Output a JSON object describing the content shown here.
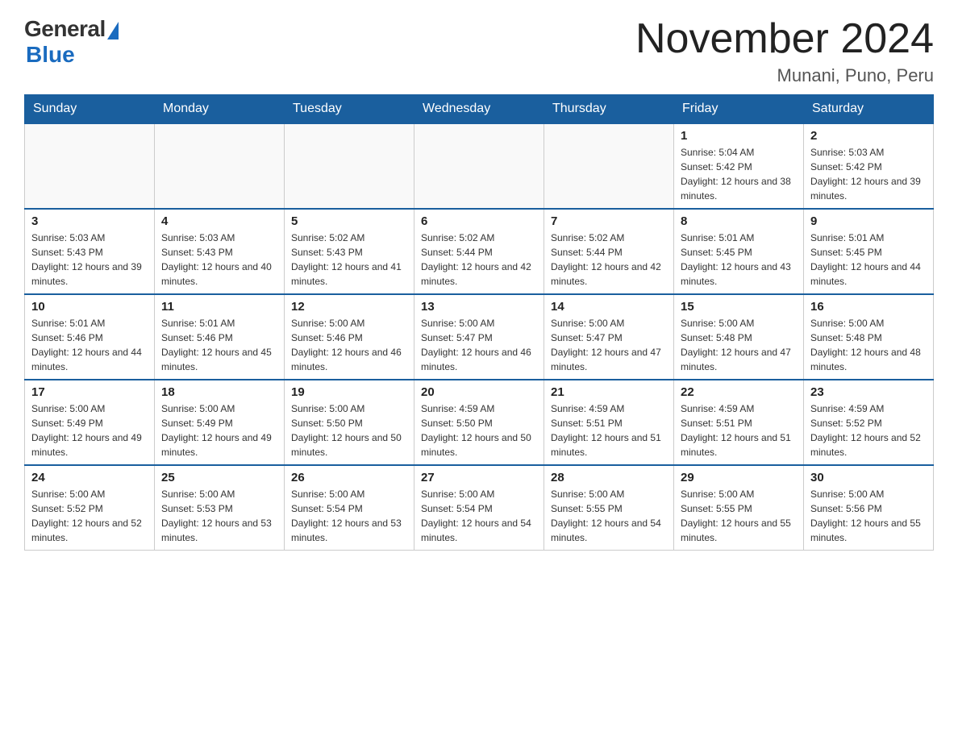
{
  "logo": {
    "general": "General",
    "blue": "Blue"
  },
  "title": "November 2024",
  "location": "Munani, Puno, Peru",
  "days_of_week": [
    "Sunday",
    "Monday",
    "Tuesday",
    "Wednesday",
    "Thursday",
    "Friday",
    "Saturday"
  ],
  "weeks": [
    [
      {
        "day": "",
        "info": ""
      },
      {
        "day": "",
        "info": ""
      },
      {
        "day": "",
        "info": ""
      },
      {
        "day": "",
        "info": ""
      },
      {
        "day": "",
        "info": ""
      },
      {
        "day": "1",
        "info": "Sunrise: 5:04 AM\nSunset: 5:42 PM\nDaylight: 12 hours and 38 minutes."
      },
      {
        "day": "2",
        "info": "Sunrise: 5:03 AM\nSunset: 5:42 PM\nDaylight: 12 hours and 39 minutes."
      }
    ],
    [
      {
        "day": "3",
        "info": "Sunrise: 5:03 AM\nSunset: 5:43 PM\nDaylight: 12 hours and 39 minutes."
      },
      {
        "day": "4",
        "info": "Sunrise: 5:03 AM\nSunset: 5:43 PM\nDaylight: 12 hours and 40 minutes."
      },
      {
        "day": "5",
        "info": "Sunrise: 5:02 AM\nSunset: 5:43 PM\nDaylight: 12 hours and 41 minutes."
      },
      {
        "day": "6",
        "info": "Sunrise: 5:02 AM\nSunset: 5:44 PM\nDaylight: 12 hours and 42 minutes."
      },
      {
        "day": "7",
        "info": "Sunrise: 5:02 AM\nSunset: 5:44 PM\nDaylight: 12 hours and 42 minutes."
      },
      {
        "day": "8",
        "info": "Sunrise: 5:01 AM\nSunset: 5:45 PM\nDaylight: 12 hours and 43 minutes."
      },
      {
        "day": "9",
        "info": "Sunrise: 5:01 AM\nSunset: 5:45 PM\nDaylight: 12 hours and 44 minutes."
      }
    ],
    [
      {
        "day": "10",
        "info": "Sunrise: 5:01 AM\nSunset: 5:46 PM\nDaylight: 12 hours and 44 minutes."
      },
      {
        "day": "11",
        "info": "Sunrise: 5:01 AM\nSunset: 5:46 PM\nDaylight: 12 hours and 45 minutes."
      },
      {
        "day": "12",
        "info": "Sunrise: 5:00 AM\nSunset: 5:46 PM\nDaylight: 12 hours and 46 minutes."
      },
      {
        "day": "13",
        "info": "Sunrise: 5:00 AM\nSunset: 5:47 PM\nDaylight: 12 hours and 46 minutes."
      },
      {
        "day": "14",
        "info": "Sunrise: 5:00 AM\nSunset: 5:47 PM\nDaylight: 12 hours and 47 minutes."
      },
      {
        "day": "15",
        "info": "Sunrise: 5:00 AM\nSunset: 5:48 PM\nDaylight: 12 hours and 47 minutes."
      },
      {
        "day": "16",
        "info": "Sunrise: 5:00 AM\nSunset: 5:48 PM\nDaylight: 12 hours and 48 minutes."
      }
    ],
    [
      {
        "day": "17",
        "info": "Sunrise: 5:00 AM\nSunset: 5:49 PM\nDaylight: 12 hours and 49 minutes."
      },
      {
        "day": "18",
        "info": "Sunrise: 5:00 AM\nSunset: 5:49 PM\nDaylight: 12 hours and 49 minutes."
      },
      {
        "day": "19",
        "info": "Sunrise: 5:00 AM\nSunset: 5:50 PM\nDaylight: 12 hours and 50 minutes."
      },
      {
        "day": "20",
        "info": "Sunrise: 4:59 AM\nSunset: 5:50 PM\nDaylight: 12 hours and 50 minutes."
      },
      {
        "day": "21",
        "info": "Sunrise: 4:59 AM\nSunset: 5:51 PM\nDaylight: 12 hours and 51 minutes."
      },
      {
        "day": "22",
        "info": "Sunrise: 4:59 AM\nSunset: 5:51 PM\nDaylight: 12 hours and 51 minutes."
      },
      {
        "day": "23",
        "info": "Sunrise: 4:59 AM\nSunset: 5:52 PM\nDaylight: 12 hours and 52 minutes."
      }
    ],
    [
      {
        "day": "24",
        "info": "Sunrise: 5:00 AM\nSunset: 5:52 PM\nDaylight: 12 hours and 52 minutes."
      },
      {
        "day": "25",
        "info": "Sunrise: 5:00 AM\nSunset: 5:53 PM\nDaylight: 12 hours and 53 minutes."
      },
      {
        "day": "26",
        "info": "Sunrise: 5:00 AM\nSunset: 5:54 PM\nDaylight: 12 hours and 53 minutes."
      },
      {
        "day": "27",
        "info": "Sunrise: 5:00 AM\nSunset: 5:54 PM\nDaylight: 12 hours and 54 minutes."
      },
      {
        "day": "28",
        "info": "Sunrise: 5:00 AM\nSunset: 5:55 PM\nDaylight: 12 hours and 54 minutes."
      },
      {
        "day": "29",
        "info": "Sunrise: 5:00 AM\nSunset: 5:55 PM\nDaylight: 12 hours and 55 minutes."
      },
      {
        "day": "30",
        "info": "Sunrise: 5:00 AM\nSunset: 5:56 PM\nDaylight: 12 hours and 55 minutes."
      }
    ]
  ]
}
